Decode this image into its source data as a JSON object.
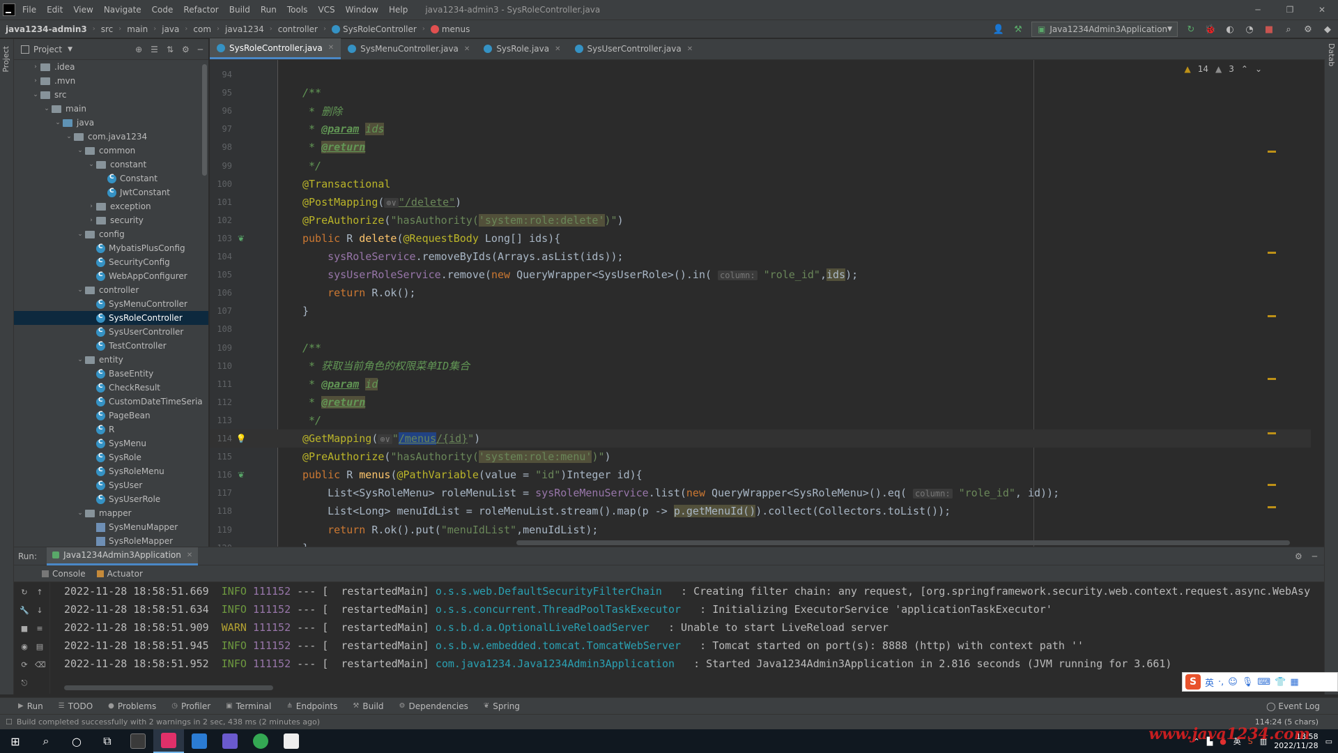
{
  "menubar": {
    "items": [
      "File",
      "Edit",
      "View",
      "Navigate",
      "Code",
      "Refactor",
      "Build",
      "Run",
      "Tools",
      "VCS",
      "Window",
      "Help"
    ],
    "title": "java1234-admin3 - SysRoleController.java"
  },
  "navbar": {
    "crumbs": [
      "java1234-admin3",
      "src",
      "main",
      "java",
      "com",
      "java1234",
      "controller"
    ],
    "class_crumb": "SysRoleController",
    "method_crumb": "menus",
    "run_config": "Java1234Admin3Application"
  },
  "project": {
    "title": "Project",
    "tree": [
      {
        "label": ".idea",
        "depth": 1,
        "type": "folder",
        "open": false
      },
      {
        "label": ".mvn",
        "depth": 1,
        "type": "folder",
        "open": false
      },
      {
        "label": "src",
        "depth": 1,
        "type": "folder",
        "open": true
      },
      {
        "label": "main",
        "depth": 2,
        "type": "folder",
        "open": true
      },
      {
        "label": "java",
        "depth": 3,
        "type": "folder-blue",
        "open": true
      },
      {
        "label": "com.java1234",
        "depth": 4,
        "type": "folder",
        "open": true
      },
      {
        "label": "common",
        "depth": 5,
        "type": "folder",
        "open": true
      },
      {
        "label": "constant",
        "depth": 6,
        "type": "folder",
        "open": true
      },
      {
        "label": "Constant",
        "depth": 7,
        "type": "class"
      },
      {
        "label": "JwtConstant",
        "depth": 7,
        "type": "class"
      },
      {
        "label": "exception",
        "depth": 6,
        "type": "folder",
        "open": false
      },
      {
        "label": "security",
        "depth": 6,
        "type": "folder",
        "open": false
      },
      {
        "label": "config",
        "depth": 5,
        "type": "folder",
        "open": true
      },
      {
        "label": "MybatisPlusConfig",
        "depth": 6,
        "type": "class"
      },
      {
        "label": "SecurityConfig",
        "depth": 6,
        "type": "class"
      },
      {
        "label": "WebAppConfigurer",
        "depth": 6,
        "type": "class"
      },
      {
        "label": "controller",
        "depth": 5,
        "type": "folder",
        "open": true
      },
      {
        "label": "SysMenuController",
        "depth": 6,
        "type": "class"
      },
      {
        "label": "SysRoleController",
        "depth": 6,
        "type": "class",
        "selected": true
      },
      {
        "label": "SysUserController",
        "depth": 6,
        "type": "class"
      },
      {
        "label": "TestController",
        "depth": 6,
        "type": "class"
      },
      {
        "label": "entity",
        "depth": 5,
        "type": "folder",
        "open": true
      },
      {
        "label": "BaseEntity",
        "depth": 6,
        "type": "class"
      },
      {
        "label": "CheckResult",
        "depth": 6,
        "type": "class"
      },
      {
        "label": "CustomDateTimeSeria",
        "depth": 6,
        "type": "class"
      },
      {
        "label": "PageBean",
        "depth": 6,
        "type": "class"
      },
      {
        "label": "R",
        "depth": 6,
        "type": "class"
      },
      {
        "label": "SysMenu",
        "depth": 6,
        "type": "class"
      },
      {
        "label": "SysRole",
        "depth": 6,
        "type": "class"
      },
      {
        "label": "SysRoleMenu",
        "depth": 6,
        "type": "class"
      },
      {
        "label": "SysUser",
        "depth": 6,
        "type": "class"
      },
      {
        "label": "SysUserRole",
        "depth": 6,
        "type": "class"
      },
      {
        "label": "mapper",
        "depth": 5,
        "type": "folder",
        "open": true
      },
      {
        "label": "SysMenuMapper",
        "depth": 6,
        "type": "mapper"
      },
      {
        "label": "SysRoleMapper",
        "depth": 6,
        "type": "mapper"
      }
    ]
  },
  "tabs": [
    {
      "label": "SysRoleController.java",
      "active": true
    },
    {
      "label": "SysMenuController.java",
      "active": false
    },
    {
      "label": "SysRole.java",
      "active": false
    },
    {
      "label": "SysUserController.java",
      "active": false
    }
  ],
  "database_tab": "Datab",
  "inspections": {
    "warnings": "14",
    "weak": "3"
  },
  "editor": {
    "lines": [
      {
        "n": "94",
        "tokens": []
      },
      {
        "n": "95",
        "tokens": [
          [
            "cm",
            "/**"
          ]
        ]
      },
      {
        "n": "96",
        "tokens": [
          [
            "cm",
            " * 删除"
          ]
        ]
      },
      {
        "n": "97",
        "tokens": [
          [
            "cm",
            " * "
          ],
          [
            "tag",
            "@param"
          ],
          [
            "cm",
            " "
          ],
          [
            "hlc",
            "ids"
          ]
        ]
      },
      {
        "n": "98",
        "tokens": [
          [
            "cm",
            " * "
          ],
          [
            "taghl",
            "@return"
          ]
        ]
      },
      {
        "n": "99",
        "tokens": [
          [
            "cm",
            " */"
          ]
        ]
      },
      {
        "n": "100",
        "tokens": [
          [
            "ann",
            "@Transactional"
          ]
        ]
      },
      {
        "n": "101",
        "tokens": [
          [
            "ann",
            "@PostMapping"
          ],
          [
            "p",
            "("
          ],
          [
            "hint",
            "⊕∨"
          ],
          [
            "url",
            "\"/delete\""
          ],
          [
            "p",
            ")"
          ]
        ]
      },
      {
        "n": "102",
        "tokens": [
          [
            "ann",
            "@PreAuthorize"
          ],
          [
            "p",
            "("
          ],
          [
            "str",
            "\"hasAuthority("
          ],
          [
            "strhl",
            "'system:role:delete'"
          ],
          [
            "str",
            ")\""
          ],
          [
            "p",
            ")"
          ]
        ]
      },
      {
        "n": "103",
        "gicon": "bean",
        "tokens": [
          [
            "kw",
            "public "
          ],
          [
            "p",
            "R "
          ],
          [
            "mth",
            "delete"
          ],
          [
            "p",
            "("
          ],
          [
            "ann",
            "@RequestBody "
          ],
          [
            "p",
            "Long[] ids){"
          ]
        ]
      },
      {
        "n": "104",
        "tokens": [
          [
            "p",
            "    "
          ],
          [
            "fld",
            "sysRoleService"
          ],
          [
            "p",
            ".removeByIds(Arrays."
          ],
          [
            "p",
            "asList(ids));"
          ]
        ]
      },
      {
        "n": "105",
        "tokens": [
          [
            "p",
            "    "
          ],
          [
            "fld",
            "sysUserRoleService"
          ],
          [
            "p",
            ".remove("
          ],
          [
            "kw",
            "new "
          ],
          [
            "p",
            "QueryWrapper<SysUserRole>().in( "
          ],
          [
            "hint",
            "column:"
          ],
          [
            "str",
            " \"role_id\""
          ],
          [
            "p",
            ","
          ],
          [
            "hlp",
            "ids"
          ],
          [
            "p",
            ");"
          ]
        ]
      },
      {
        "n": "106",
        "tokens": [
          [
            "p",
            "    "
          ],
          [
            "kw",
            "return "
          ],
          [
            "p",
            "R."
          ],
          [
            "p",
            "ok();"
          ]
        ]
      },
      {
        "n": "107",
        "tokens": [
          [
            "p",
            "}"
          ]
        ]
      },
      {
        "n": "108",
        "tokens": []
      },
      {
        "n": "109",
        "tokens": [
          [
            "cm",
            "/**"
          ]
        ]
      },
      {
        "n": "110",
        "tokens": [
          [
            "cm",
            " * 获取当前角色的权限菜单ID集合"
          ]
        ]
      },
      {
        "n": "111",
        "tokens": [
          [
            "cm",
            " * "
          ],
          [
            "tag",
            "@param"
          ],
          [
            "cm",
            " "
          ],
          [
            "hlc",
            "id"
          ]
        ]
      },
      {
        "n": "112",
        "tokens": [
          [
            "cm",
            " * "
          ],
          [
            "taghl",
            "@return"
          ]
        ]
      },
      {
        "n": "113",
        "tokens": [
          [
            "cm",
            " */"
          ]
        ]
      },
      {
        "n": "114",
        "cur": true,
        "gicon": "bulb",
        "tokens": [
          [
            "ann",
            "@GetMapping"
          ],
          [
            "p",
            "("
          ],
          [
            "hint",
            "⊕∨"
          ],
          [
            "str",
            "\""
          ],
          [
            "sel",
            "/menus"
          ],
          [
            "url",
            "/{id}"
          ],
          [
            "str",
            "\""
          ],
          [
            "p",
            ")"
          ]
        ]
      },
      {
        "n": "115",
        "tokens": [
          [
            "ann",
            "@PreAuthorize"
          ],
          [
            "p",
            "("
          ],
          [
            "str",
            "\"hasAuthority("
          ],
          [
            "strhl",
            "'system:role:menu'"
          ],
          [
            "str",
            ")\""
          ],
          [
            "p",
            ")"
          ]
        ]
      },
      {
        "n": "116",
        "gicon": "bean",
        "tokens": [
          [
            "kw",
            "public "
          ],
          [
            "p",
            "R "
          ],
          [
            "mth",
            "menus"
          ],
          [
            "p",
            "("
          ],
          [
            "ann",
            "@PathVariable"
          ],
          [
            "p",
            "(value = "
          ],
          [
            "str",
            "\"id\""
          ],
          [
            "p",
            ")Integer id){"
          ]
        ]
      },
      {
        "n": "117",
        "tokens": [
          [
            "p",
            "    List<SysRoleMenu> roleMenuList = "
          ],
          [
            "fld",
            "sysRoleMenuService"
          ],
          [
            "p",
            ".list("
          ],
          [
            "kw",
            "new "
          ],
          [
            "p",
            "QueryWrapper<SysRoleMenu>().eq( "
          ],
          [
            "hint",
            "column:"
          ],
          [
            "str",
            " \"role_id\""
          ],
          [
            "p",
            ", id));"
          ]
        ]
      },
      {
        "n": "118",
        "tokens": [
          [
            "p",
            "    List<Long> menuIdList = roleMenuList.stream().map(p -> "
          ],
          [
            "hlp",
            "p.getMenuId()"
          ],
          [
            "p",
            ").collect(Collectors."
          ],
          [
            "p",
            "toList());"
          ]
        ]
      },
      {
        "n": "119",
        "tokens": [
          [
            "p",
            "    "
          ],
          [
            "kw",
            "return "
          ],
          [
            "p",
            "R."
          ],
          [
            "p",
            "ok().put("
          ],
          [
            "str",
            "\"menuIdList\""
          ],
          [
            "p",
            ",menuIdList);"
          ]
        ]
      },
      {
        "n": "120",
        "tokens": [
          [
            "p",
            "}"
          ]
        ]
      }
    ]
  },
  "run": {
    "label": "Run:",
    "app": "Java1234Admin3Application",
    "subtabs": [
      "Console",
      "Actuator"
    ],
    "logs": [
      {
        "ts": "2022-11-28 18:58:51.669",
        "lvl": "INFO",
        "pid": "111152",
        "thread": "restartedMain]",
        "logger": "o.s.s.web.DefaultSecurityFilterChain",
        "msg": ": Creating filter chain: any request, [org.springframework.security.web.context.request.async.WebAsy"
      },
      {
        "ts": "2022-11-28 18:58:51.634",
        "lvl": "INFO",
        "pid": "111152",
        "thread": "restartedMain]",
        "logger": "o.s.s.concurrent.ThreadPoolTaskExecutor",
        "msg": ": Initializing ExecutorService 'applicationTaskExecutor'"
      },
      {
        "ts": "2022-11-28 18:58:51.909",
        "lvl": "WARN",
        "pid": "111152",
        "thread": "restartedMain]",
        "logger": "o.s.b.d.a.OptionalLiveReloadServer",
        "msg": ": Unable to start LiveReload server"
      },
      {
        "ts": "2022-11-28 18:58:51.945",
        "lvl": "INFO",
        "pid": "111152",
        "thread": "restartedMain]",
        "logger": "o.s.b.w.embedded.tomcat.TomcatWebServer",
        "msg": ": Tomcat started on port(s): 8888 (http) with context path ''"
      },
      {
        "ts": "2022-11-28 18:58:51.952",
        "lvl": "INFO",
        "pid": "111152",
        "thread": "restartedMain]",
        "logger": "com.java1234.Java1234Admin3Application",
        "msg": ": Started Java1234Admin3Application in 2.816 seconds (JVM running for 3.661)"
      }
    ]
  },
  "toolwindows": [
    "Run",
    "TODO",
    "Problems",
    "Profiler",
    "Terminal",
    "Endpoints",
    "Build",
    "Dependencies",
    "Spring"
  ],
  "event_log": "Event Log",
  "status": {
    "message": "Build completed successfully with 2 warnings in 2 sec, 438 ms (2 minutes ago)",
    "position": "114:24 (5 chars)"
  },
  "ime": {
    "lang": "英"
  },
  "taskbar": {
    "time": "18:58",
    "date": "2022/11/28"
  },
  "watermark": "www.java1234.com"
}
